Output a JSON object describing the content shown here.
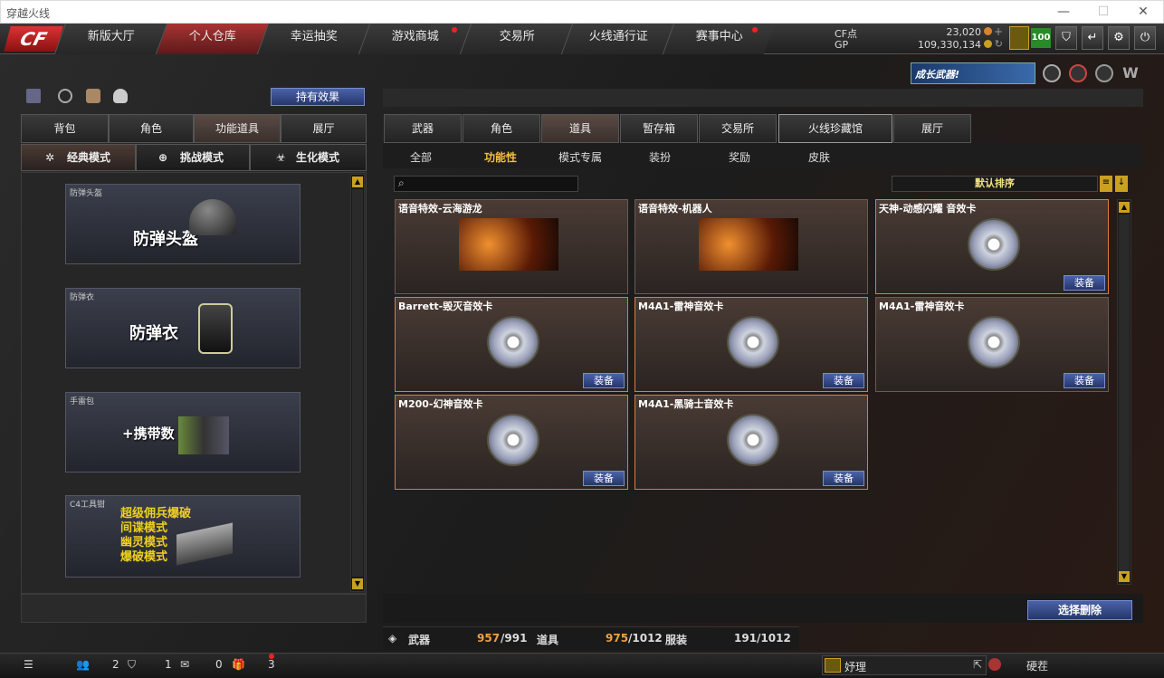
{
  "window": {
    "title": "穿越火线",
    "min": "—",
    "max": "☐",
    "close": "✕"
  },
  "logo": "CF",
  "nav": [
    {
      "label": "新版大厅"
    },
    {
      "label": "个人仓库"
    },
    {
      "label": "幸运抽奖"
    },
    {
      "label": "游戏商城"
    },
    {
      "label": "交易所"
    },
    {
      "label": "火线通行证"
    },
    {
      "label": "赛事中心"
    }
  ],
  "currency": {
    "cf_label": "CF点",
    "cf_value": "23,020",
    "gp_label": "GP",
    "gp_value": "109,330,134"
  },
  "level_badge": "100",
  "banner_text": "成长武器!",
  "effects_button": "持有效果",
  "left_tabs": [
    "背包",
    "角色",
    "功能道具",
    "展厅"
  ],
  "mode_tabs": [
    "经典模式",
    "挑战模式",
    "生化模式"
  ],
  "left_items": [
    {
      "name": "防弹头盔",
      "big": "防弹头盔"
    },
    {
      "name": "防弹衣",
      "big": "防弹衣"
    },
    {
      "name": "手雷包",
      "big": "+携带数"
    },
    {
      "name": "C4工具钳",
      "lines": [
        "超级佣兵爆破",
        "间谍模式",
        "幽灵模式",
        "爆破模式"
      ]
    }
  ],
  "right_tabs": [
    "武器",
    "角色",
    "道具",
    "暂存箱",
    "交易所",
    "火线珍藏馆",
    "展厅"
  ],
  "filter_tabs": [
    "全部",
    "功能性",
    "模式专属",
    "装扮",
    "奖励",
    "皮肤"
  ],
  "sort": "默认排序",
  "equip_label": "装备",
  "items": [
    {
      "name": "语音特效-云海游龙",
      "type": "img"
    },
    {
      "name": "语音特效-机器人",
      "type": "img"
    },
    {
      "name": "天神-动感闪耀 音效卡",
      "type": "cd",
      "equip": true
    },
    {
      "name": "Barrett-毁灭音效卡",
      "type": "cd",
      "equip": true
    },
    {
      "name": "M4A1-雷神音效卡",
      "type": "cd",
      "equip": true
    },
    {
      "name": "M4A1-雷神音效卡",
      "type": "cd",
      "equip": true
    },
    {
      "name": "M200-幻神音效卡",
      "type": "cd",
      "equip": true
    },
    {
      "name": "M4A1-黑骑士音效卡",
      "type": "cd",
      "equip": true
    }
  ],
  "select_delete": "选择删除",
  "stats": {
    "weapon_label": "武器",
    "weapon_val": "957",
    "weapon_max": "/991",
    "item_label": "道具",
    "item_val": "975",
    "item_max": "/1012",
    "outfit_label": "服装",
    "outfit_val": "191/1012"
  },
  "bottom": {
    "friends": "2",
    "shield": "1",
    "chat": "0",
    "gift": "3",
    "user1": "妤理",
    "user2": "硬茬"
  }
}
